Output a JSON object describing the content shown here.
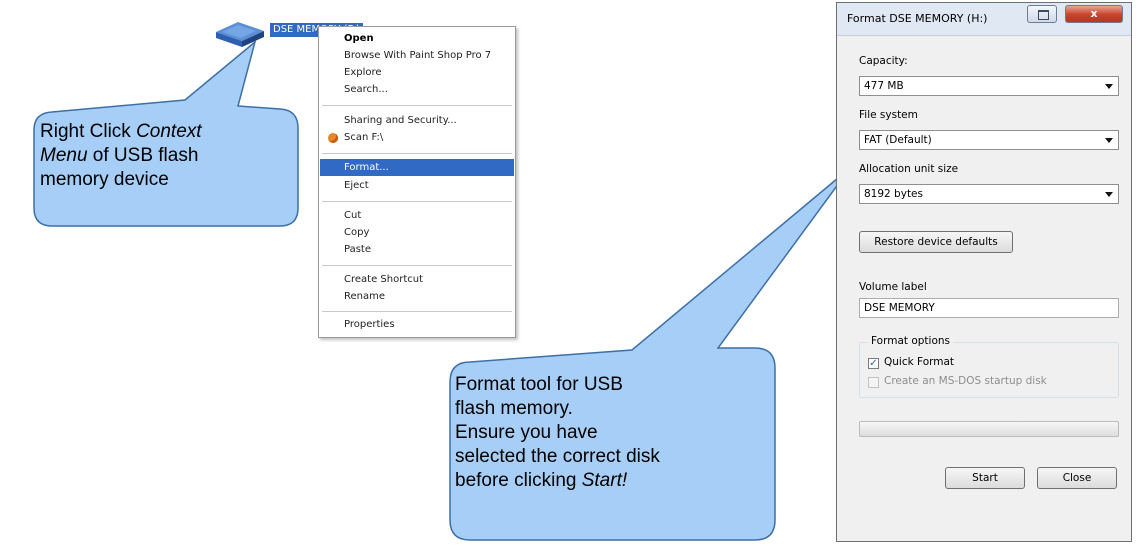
{
  "drive": {
    "label": "DSE MEMORY (F:)",
    "icon": "usb-drive-icon"
  },
  "context_menu": {
    "items": [
      {
        "label": "Open",
        "bold": true
      },
      {
        "label": "Browse With Paint Shop Pro 7"
      },
      {
        "label": "Explore"
      },
      {
        "label": "Search..."
      },
      {
        "label": "Sharing and Security..."
      },
      {
        "label": "Scan F:\\",
        "icon": "scan-icon"
      },
      {
        "label": "Format...",
        "highlighted": true
      },
      {
        "label": "Eject"
      },
      {
        "label": "Cut"
      },
      {
        "label": "Copy"
      },
      {
        "label": "Paste"
      },
      {
        "label": "Create Shortcut"
      },
      {
        "label": "Rename"
      },
      {
        "label": "Properties"
      }
    ],
    "highlight_color": "#316ac5"
  },
  "callouts": {
    "left": {
      "line1_a": "Right Click ",
      "line1_b": "Context",
      "line2_a": "Menu",
      "line2_b": " of USB flash",
      "line3": "memory device"
    },
    "middle": {
      "line1": "Format tool for USB",
      "line2": "flash memory.",
      "line3": "Ensure you have",
      "line4": "selected the correct disk",
      "line5_a": "before clicking ",
      "line5_b": "Start!"
    },
    "fill_color": "#a6cef7",
    "stroke_color": "#3d6fa8"
  },
  "dialog": {
    "title": "Format DSE MEMORY (H:)",
    "close_label": "x",
    "capacity_label": "Capacity:",
    "capacity_value": "477 MB",
    "filesystem_label": "File system",
    "filesystem_value": "FAT (Default)",
    "allocation_label": "Allocation unit size",
    "allocation_value": "8192 bytes",
    "restore_button": "Restore device defaults",
    "volume_label_label": "Volume label",
    "volume_label_value": "DSE MEMORY",
    "format_options_title": "Format options",
    "quick_format_label": "Quick Format",
    "quick_format_checked": true,
    "msdos_label": "Create an MS-DOS startup disk",
    "msdos_checked": false,
    "progress": 0,
    "start_button": "Start",
    "close_button": "Close"
  }
}
